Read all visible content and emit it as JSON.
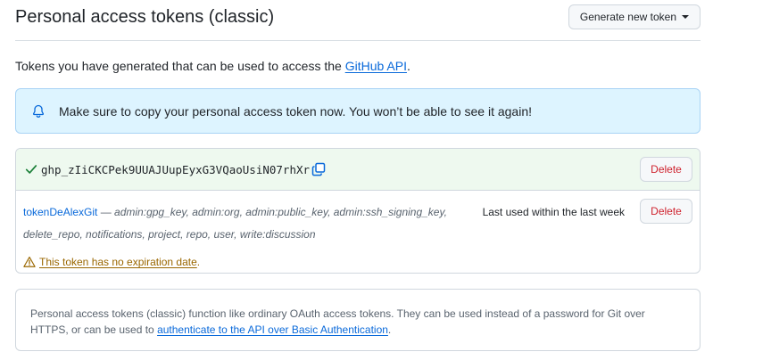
{
  "header": {
    "title": "Personal access tokens (classic)",
    "generate_button_label": "Generate new token"
  },
  "intro": {
    "text": "Tokens you have generated that can be used to access the ",
    "link_text": "GitHub API",
    "suffix": "."
  },
  "flash": {
    "icon": "bell-icon",
    "message": "Make sure to copy your personal access token now. You won’t be able to see it again!"
  },
  "new_token": {
    "value": "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",
    "delete_label": "Delete"
  },
  "token": {
    "name": "tokenDeAlexGit",
    "separator": " — ",
    "scopes": "admin:gpg_key, admin:org, admin:public_key, admin:ssh_signing_key, delete_repo, notifications, project, repo, user, write:discussion",
    "last_used": "Last used within the last week",
    "delete_label": "Delete",
    "warning": "This token has no expiration date",
    "warning_suffix": "."
  },
  "info": {
    "text": "Personal access tokens (classic) function like ordinary OAuth access tokens. They can be used instead of a password for Git over HTTPS, or can be used to ",
    "link_text": "authenticate to the API over Basic Authentication",
    "suffix": "."
  },
  "colors": {
    "link": "#0969da",
    "danger": "#cf222e",
    "success": "#1a7f37",
    "warning": "#9a6700",
    "flash_bg": "#ddf4ff",
    "new_token_bg": "#eef9ef"
  }
}
